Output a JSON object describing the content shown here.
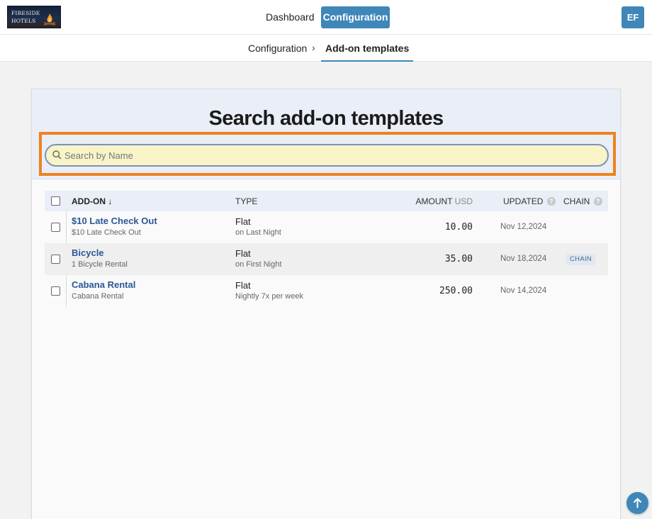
{
  "brand": {
    "logo_text": "Fireside Hotels"
  },
  "nav": {
    "dashboard_label": "Dashboard",
    "configuration_label": "Configuration",
    "user_initials": "EF"
  },
  "breadcrumb": {
    "parent": "Configuration",
    "separator": "›",
    "current": "Add-on templates"
  },
  "page": {
    "title": "Search add-on templates"
  },
  "search": {
    "placeholder": "Search by Name",
    "value": ""
  },
  "table": {
    "headers": {
      "addon": "ADD-ON",
      "sort_arrow": "↓",
      "type": "TYPE",
      "amount": "AMOUNT",
      "amount_unit": "USD",
      "updated": "UPDATED",
      "chain": "CHAIN",
      "help": "?"
    },
    "rows": [
      {
        "name": "$10 Late Check Out",
        "description": "$10 Late Check Out",
        "type": "Flat",
        "type_detail": "on Last Night",
        "amount": "10.00",
        "updated": "Nov 12,2024",
        "chain": ""
      },
      {
        "name": "Bicycle",
        "description": "1 Bicycle Rental",
        "type": "Flat",
        "type_detail": "on First Night",
        "amount": "35.00",
        "updated": "Nov 18,2024",
        "chain": "CHAIN"
      },
      {
        "name": "Cabana Rental",
        "description": "Cabana Rental",
        "type": "Flat",
        "type_detail": "Nightly 7x per week",
        "amount": "250.00",
        "updated": "Nov 14,2024",
        "chain": ""
      }
    ]
  },
  "colors": {
    "accent": "#3f87b8",
    "link": "#2c5797",
    "highlight_border": "#f0821e",
    "search_background": "#f8f4c8",
    "header_background": "#e9eef7"
  },
  "icons": {
    "search": "search-icon",
    "scroll_top": "arrow-up-icon",
    "logo": "campfire-icon"
  }
}
